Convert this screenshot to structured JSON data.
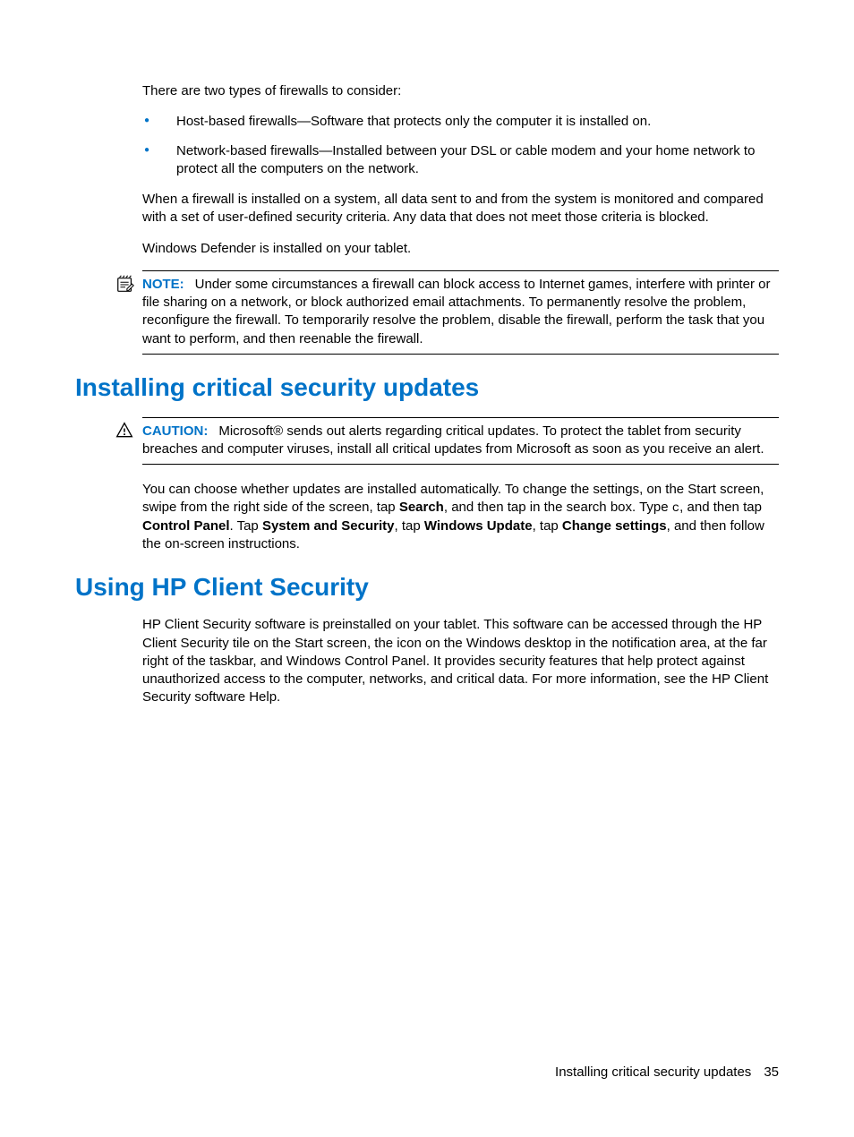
{
  "intro_para": "There are two types of firewalls to consider:",
  "bullets": [
    "Host-based firewalls—Software that protects only the computer it is installed on.",
    "Network-based firewalls—Installed between your DSL or cable modem and your home network to protect all the computers on the network."
  ],
  "para_after_bullets": "When a firewall is installed on a system, all data sent to and from the system is monitored and compared with a set of user-defined security criteria. Any data that does not meet those criteria is blocked.",
  "defender_para": "Windows Defender is installed on your tablet.",
  "note_label": "NOTE:",
  "note_text": "Under some circumstances a firewall can block access to Internet games, interfere with printer or file sharing on a network, or block authorized email attachments. To permanently resolve the problem, reconfigure the firewall. To temporarily resolve the problem, disable the firewall, perform the task that you want to perform, and then reenable the firewall.",
  "section1_title": "Installing critical security updates",
  "caution_label": "CAUTION:",
  "caution_text": "Microsoft® sends out alerts regarding critical updates. To protect the tablet from security breaches and computer viruses, install all critical updates from Microsoft as soon as you receive an alert.",
  "auto_updates": {
    "p1": "You can choose whether updates are installed automatically. To change the settings, on the Start screen, swipe from the right side of the screen, tap ",
    "b1": "Search",
    "p2": ", and then tap in the search box. Type ",
    "code": "c",
    "p3": ", and then tap ",
    "b2": "Control Panel",
    "p4": ". Tap ",
    "b3": "System and Security",
    "p5": ", tap ",
    "b4": "Windows Update",
    "p6": ", tap ",
    "b5": "Change settings",
    "p7": ", and then follow the on-screen instructions."
  },
  "section2_title": "Using HP Client Security",
  "hp_client_para": "HP Client Security software is preinstalled on your tablet. This software can be accessed through the HP Client Security tile on the Start screen, the icon on the Windows desktop in the notification area, at the far right of the taskbar, and Windows Control Panel. It provides security features that help protect against unauthorized access to the computer, networks, and critical data. For more information, see the HP Client Security software Help.",
  "footer_title": "Installing critical security updates",
  "footer_page": "35"
}
